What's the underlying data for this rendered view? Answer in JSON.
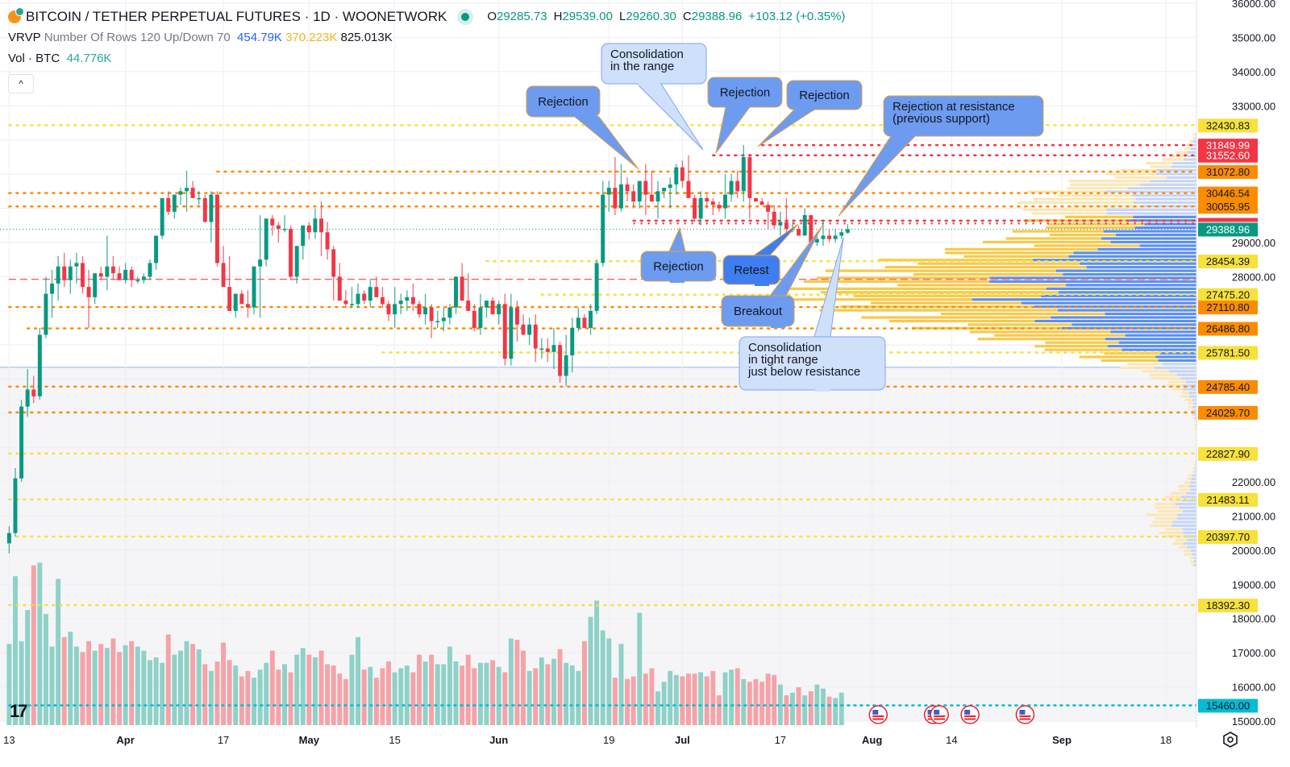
{
  "header": {
    "title": "BITCOIN / TETHER PERPETUAL FUTURES · 1D · WOONETWORK",
    "symbol_icon": "bitcoin-icon",
    "market_status": "market-open-dot",
    "ohlc": {
      "open_label": "O",
      "open": "29285.73",
      "high_label": "H",
      "high": "29539.00",
      "low_label": "L",
      "low": "29260.30",
      "close_label": "C",
      "close": "29388.96",
      "change": "+103.12 (+0.35%)"
    }
  },
  "indicators": {
    "vrvp": {
      "name": "VRVP",
      "params": "Number Of Rows 120 Up/Down 70",
      "up": "454.79K",
      "down": "370.223K",
      "total": "825.013K"
    },
    "volume": {
      "name": "Vol · BTC",
      "value": "44.776K"
    },
    "collapse_label": "^"
  },
  "colors": {
    "up": "#089981",
    "down": "#f23645",
    "vol_up": "#8fd1c7",
    "vol_down": "#f5a3a8",
    "vp_up": "#5b8ff0",
    "vp_down": "#f7c94a",
    "vp_up_light": "#c7d6f7",
    "vp_down_light": "#fbe7b8",
    "annotation": "#6d9bf0",
    "annotation_light": "#cfe0fb",
    "annotation_border": "#e0a040",
    "yellow_level": "#f7e13a",
    "orange_level": "#fb8c00",
    "red_level": "#f23645",
    "cyan_level": "#00bcd4"
  },
  "chart_data": {
    "type": "candlestick",
    "title": "BITCOIN / TETHER PERPETUAL FUTURES · 1D · WOONETWORK",
    "ylim": [
      15000,
      36000
    ],
    "y_ticks": [
      "36000.00",
      "35000.00",
      "34000.00",
      "33000.00",
      "29000.00",
      "28000.00",
      "22000.00",
      "21000.00",
      "20000.00",
      "19000.00",
      "18000.00",
      "17000.00",
      "16000.00",
      "15000.00"
    ],
    "y_tick_values": [
      36000,
      35000,
      34000,
      33000,
      29000,
      28000,
      22000,
      21000,
      20000,
      19000,
      18000,
      17000,
      16000,
      15000
    ],
    "x_ticks": [
      {
        "label": "13",
        "day": 0,
        "bold": false
      },
      {
        "label": "Apr",
        "day": 19,
        "bold": true
      },
      {
        "label": "17",
        "day": 35,
        "bold": false
      },
      {
        "label": "May",
        "day": 49,
        "bold": true
      },
      {
        "label": "15",
        "day": 63,
        "bold": false
      },
      {
        "label": "Jun",
        "day": 80,
        "bold": true
      },
      {
        "label": "19",
        "day": 98,
        "bold": false
      },
      {
        "label": "Jul",
        "day": 110,
        "bold": true
      },
      {
        "label": "17",
        "day": 126,
        "bold": false
      },
      {
        "label": "Aug",
        "day": 141,
        "bold": true
      },
      {
        "label": "14",
        "day": 154,
        "bold": false
      },
      {
        "label": "Sep",
        "day": 172,
        "bold": true
      },
      {
        "label": "18",
        "day": 189,
        "bold": false
      }
    ],
    "x_range_days": [
      -1.5,
      194
    ],
    "last_price": 29388.96,
    "price_levels": [
      {
        "value": 32430.83,
        "style": "yellow",
        "from_day": 0
      },
      {
        "value": 31849.99,
        "style": "red",
        "from_day": 123
      },
      {
        "value": 31552.6,
        "style": "red",
        "from_day": 115
      },
      {
        "value": 31072.8,
        "style": "orange",
        "from_day": 34
      },
      {
        "value": 30446.54,
        "style": "orange",
        "from_day": 0
      },
      {
        "value": 30055.95,
        "style": "orange",
        "from_day": 0
      },
      {
        "value": 29640,
        "style": "red-noLabel",
        "from_day": 102
      },
      {
        "value": 28454.39,
        "style": "yellow",
        "from_day": 78
      },
      {
        "value": 27925,
        "style": "reddash-noLabel",
        "from_day": 0
      },
      {
        "value": 27475.2,
        "style": "yellow",
        "from_day": 87
      },
      {
        "value": 27110.8,
        "style": "orange",
        "from_day": 0
      },
      {
        "value": 26486.8,
        "style": "orange",
        "from_day": 3
      },
      {
        "value": 25781.5,
        "style": "yellow",
        "from_day": 61
      },
      {
        "value": 24785.4,
        "style": "orange",
        "from_day": 0
      },
      {
        "value": 24029.7,
        "style": "orange",
        "from_day": 0
      },
      {
        "value": 22827.9,
        "style": "yellow",
        "from_day": 0
      },
      {
        "value": 21483.11,
        "style": "yellow",
        "from_day": 0
      },
      {
        "value": 20397.7,
        "style": "yellow",
        "from_day": 0
      },
      {
        "value": 18392.3,
        "style": "yellow",
        "from_day": 0
      },
      {
        "value": 15460.0,
        "style": "cyan",
        "from_day": 0
      }
    ],
    "candles": [
      [
        20200,
        20700,
        19900,
        20500
      ],
      [
        20500,
        22400,
        20400,
        22100
      ],
      [
        22100,
        24400,
        22000,
        24200
      ],
      [
        24200,
        25300,
        23900,
        24700
      ],
      [
        24700,
        25100,
        24300,
        24500
      ],
      [
        24500,
        26500,
        24400,
        26300
      ],
      [
        26300,
        28000,
        26200,
        27500
      ],
      [
        27500,
        28200,
        26800,
        27800
      ],
      [
        27800,
        28600,
        27300,
        28300
      ],
      [
        28300,
        28700,
        27700,
        27900
      ],
      [
        27900,
        28500,
        27500,
        28300
      ],
      [
        28300,
        28700,
        27800,
        28400
      ],
      [
        28400,
        28600,
        27500,
        27700
      ],
      [
        27700,
        28200,
        26500,
        27400
      ],
      [
        27400,
        28100,
        27200,
        28100
      ],
      [
        28100,
        28300,
        27900,
        28000
      ],
      [
        28000,
        29200,
        27600,
        28300
      ],
      [
        28300,
        28600,
        27900,
        28100
      ],
      [
        28100,
        28300,
        27900,
        27900
      ],
      [
        27900,
        28400,
        27800,
        28200
      ],
      [
        28200,
        28300,
        27700,
        27900
      ],
      [
        27900,
        28000,
        27800,
        27900
      ],
      [
        27900,
        28100,
        27800,
        28000
      ],
      [
        28000,
        28500,
        27900,
        28400
      ],
      [
        28400,
        29100,
        28200,
        29200
      ],
      [
        29200,
        30100,
        29100,
        30300
      ],
      [
        30300,
        30500,
        29800,
        29900
      ],
      [
        29900,
        30300,
        29700,
        30400
      ],
      [
        30400,
        30600,
        30100,
        30500
      ],
      [
        30500,
        31100,
        29900,
        30600
      ],
      [
        30600,
        30800,
        30300,
        30300
      ],
      [
        30300,
        30500,
        30100,
        30300
      ],
      [
        30300,
        30400,
        29900,
        29600
      ],
      [
        29600,
        30500,
        29000,
        30400
      ],
      [
        30400,
        30500,
        28300,
        28400
      ],
      [
        28400,
        28900,
        27900,
        27700
      ],
      [
        27700,
        28600,
        27300,
        27000
      ],
      [
        27000,
        27500,
        26800,
        27500
      ],
      [
        27500,
        27600,
        27200,
        27200
      ],
      [
        27200,
        27600,
        26800,
        27100
      ],
      [
        27100,
        28300,
        26900,
        28300
      ],
      [
        28300,
        29800,
        26800,
        28500
      ],
      [
        28500,
        29700,
        28300,
        29700
      ],
      [
        29700,
        29800,
        29200,
        29500
      ],
      [
        29500,
        29600,
        29000,
        29400
      ],
      [
        29400,
        29800,
        29300,
        29400
      ],
      [
        29400,
        29500,
        27900,
        28000
      ],
      [
        28000,
        28800,
        27800,
        28900
      ],
      [
        28900,
        29400,
        28500,
        29500
      ],
      [
        29500,
        29600,
        29100,
        29300
      ],
      [
        29300,
        30000,
        29100,
        29700
      ],
      [
        29700,
        30200,
        28600,
        29300
      ],
      [
        29300,
        29600,
        28500,
        28800
      ],
      [
        28800,
        28900,
        27300,
        28000
      ],
      [
        28000,
        28400,
        27300,
        27300
      ],
      [
        27300,
        27600,
        27100,
        27200
      ],
      [
        27200,
        27700,
        27100,
        27200
      ],
      [
        27200,
        27800,
        27100,
        27500
      ],
      [
        27500,
        27600,
        27200,
        27300
      ],
      [
        27300,
        27900,
        27100,
        27700
      ],
      [
        27700,
        28000,
        27400,
        27400
      ],
      [
        27400,
        27700,
        27100,
        27200
      ],
      [
        27200,
        27300,
        26700,
        26900
      ],
      [
        26900,
        27700,
        26500,
        27200
      ],
      [
        27200,
        27500,
        26900,
        27300
      ],
      [
        27300,
        27600,
        27000,
        27400
      ],
      [
        27400,
        27800,
        27000,
        27200
      ],
      [
        27200,
        27300,
        26800,
        26900
      ],
      [
        26900,
        27500,
        26600,
        27100
      ],
      [
        27100,
        27200,
        26200,
        26700
      ],
      [
        26700,
        27000,
        26500,
        26700
      ],
      [
        26700,
        27100,
        26400,
        26800
      ],
      [
        26800,
        27200,
        26600,
        27100
      ],
      [
        27100,
        28000,
        26900,
        28000
      ],
      [
        28000,
        28400,
        27300,
        27300
      ],
      [
        27300,
        28100,
        27000,
        27000
      ],
      [
        27000,
        27200,
        26400,
        26500
      ],
      [
        26500,
        27500,
        26300,
        27100
      ],
      [
        27100,
        27300,
        26800,
        27300
      ],
      [
        27300,
        27400,
        27000,
        26900
      ],
      [
        26900,
        27300,
        26600,
        27200
      ],
      [
        27200,
        27500,
        25400,
        25600
      ],
      [
        25600,
        27500,
        25400,
        27100
      ],
      [
        27100,
        27300,
        26100,
        26600
      ],
      [
        26600,
        26900,
        26300,
        26300
      ],
      [
        26300,
        26800,
        26000,
        26600
      ],
      [
        26600,
        26900,
        25500,
        25900
      ],
      [
        25900,
        26200,
        25600,
        25900
      ],
      [
        25900,
        26200,
        25500,
        25800
      ],
      [
        25800,
        26500,
        25300,
        26000
      ],
      [
        26000,
        26100,
        24900,
        25100
      ],
      [
        25100,
        26300,
        24800,
        25700
      ],
      [
        25700,
        26800,
        25200,
        26500
      ],
      [
        26500,
        27100,
        26400,
        26800
      ],
      [
        26800,
        26900,
        26500,
        26500
      ],
      [
        26500,
        27200,
        26300,
        27000
      ],
      [
        27000,
        28500,
        26900,
        28400
      ],
      [
        28400,
        30800,
        28300,
        30400
      ],
      [
        30400,
        30800,
        29900,
        30600
      ],
      [
        30600,
        31500,
        29800,
        30000
      ],
      [
        30000,
        31300,
        29900,
        30700
      ],
      [
        30700,
        30900,
        30200,
        30500
      ],
      [
        30500,
        30700,
        30000,
        30200
      ],
      [
        30200,
        30800,
        30000,
        30800
      ],
      [
        30800,
        31300,
        29800,
        30400
      ],
      [
        30400,
        31100,
        30200,
        30200
      ],
      [
        30200,
        30800,
        29700,
        30500
      ],
      [
        30500,
        30600,
        30300,
        30600
      ],
      [
        30600,
        30900,
        30000,
        30700
      ],
      [
        30700,
        31300,
        30400,
        31200
      ],
      [
        31200,
        31400,
        30600,
        30800
      ],
      [
        30800,
        31550,
        30600,
        30300
      ],
      [
        30300,
        30400,
        29600,
        29700
      ],
      [
        29700,
        30500,
        29500,
        30300
      ],
      [
        30300,
        30400,
        30000,
        30200
      ],
      [
        30200,
        30300,
        29800,
        30100
      ],
      [
        30100,
        30200,
        29900,
        30000
      ],
      [
        30000,
        31000,
        29700,
        30400
      ],
      [
        30400,
        31000,
        30200,
        30800
      ],
      [
        30800,
        31100,
        30300,
        30500
      ],
      [
        30500,
        31850,
        30200,
        31500
      ],
      [
        31500,
        31600,
        29700,
        30300
      ],
      [
        30300,
        30300,
        30200,
        30200
      ],
      [
        30200,
        30300,
        30100,
        30100
      ],
      [
        30100,
        30200,
        29400,
        29900
      ],
      [
        29900,
        30100,
        29400,
        29500
      ],
      [
        29500,
        29900,
        29200,
        29600
      ],
      [
        29600,
        30300,
        29200,
        29400
      ],
      [
        29400,
        29600,
        29300,
        29400
      ],
      [
        29400,
        29500,
        29200,
        29200
      ],
      [
        29200,
        30000,
        29200,
        29800
      ],
      [
        29800,
        29800,
        29000,
        29000
      ],
      [
        29000,
        29300,
        28900,
        29100
      ],
      [
        29100,
        29600,
        28900,
        29200
      ],
      [
        29200,
        29400,
        29000,
        29100
      ],
      [
        29100,
        29400,
        29000,
        29200
      ],
      [
        29200,
        29400,
        29100,
        29300
      ],
      [
        29285.73,
        29539,
        29260.3,
        29388.96
      ]
    ],
    "volume": {
      "max_shown": 125,
      "values": [
        60,
        110,
        62,
        85,
        118,
        120,
        82,
        58,
        108,
        65,
        69,
        58,
        54,
        62,
        55,
        60,
        57,
        64,
        54,
        59,
        62,
        58,
        55,
        48,
        50,
        46,
        67,
        52,
        55,
        62,
        60,
        56,
        45,
        40,
        47,
        61,
        48,
        44,
        36,
        40,
        35,
        41,
        46,
        55,
        41,
        45,
        39,
        52,
        57,
        52,
        50,
        55,
        45,
        44,
        38,
        34,
        52,
        65,
        41,
        43,
        35,
        42,
        47,
        39,
        42,
        44,
        39,
        52,
        47,
        52,
        45,
        45,
        58,
        47,
        44,
        52,
        42,
        46,
        46,
        48,
        43,
        39,
        64,
        63,
        55,
        40,
        42,
        50,
        45,
        49,
        56,
        46,
        44,
        40,
        62,
        80,
        92,
        70,
        64,
        35,
        60,
        34,
        36,
        83,
        38,
        42,
        25,
        32,
        40,
        37,
        36,
        38,
        38,
        39,
        36,
        40,
        22,
        39,
        41,
        42,
        34,
        32,
        34,
        32,
        38,
        37,
        30,
        22,
        24,
        28,
        22,
        25,
        30,
        27,
        21,
        20,
        24
      ],
      "up_flags": "mixed"
    },
    "volume_profile": {
      "rows_note": "Horizontal volume-at-price bars on right side; up volume in blue, down volume in yellow",
      "peak_price_range": [
        25500,
        29800
      ],
      "value_area_high": 29800,
      "value_area_low": 25500
    },
    "annotations": [
      {
        "text": "Rejection",
        "style": "dark",
        "target_day": 103,
        "target_price": 31450
      },
      {
        "text": "Consolidation\nin the range",
        "style": "light",
        "target_day": 113,
        "target_price": 31700
      },
      {
        "text": "Rejection",
        "style": "dark",
        "target_day": 117,
        "target_price": 31550
      },
      {
        "text": "Rejection",
        "style": "dark",
        "target_day": 124,
        "target_price": 31850
      },
      {
        "text": "Rejection at resistance\n(previous support)",
        "style": "dark",
        "target_day": 136,
        "target_price": 29620
      },
      {
        "text": "Rejection",
        "style": "dark",
        "target_day": 110,
        "target_price": 29600
      },
      {
        "text": "Retest",
        "style": "darker",
        "target_day": 130,
        "target_price": 29500
      },
      {
        "text": "Breakout",
        "style": "dark",
        "target_day": 133,
        "target_price": 29800
      },
      {
        "text": "Consolidation\nin tight range\njust below resistance",
        "style": "light",
        "target_day": 137,
        "target_price": 29200
      }
    ],
    "event_markers": [
      {
        "icon": "us-flag-icon",
        "day": 142
      },
      {
        "icon": "us-flag-icon",
        "day": 151
      },
      {
        "icon": "us-flag-icon",
        "day": 152
      },
      {
        "icon": "us-flag-icon",
        "day": 157
      },
      {
        "icon": "us-flag-icon",
        "day": 166
      }
    ]
  }
}
